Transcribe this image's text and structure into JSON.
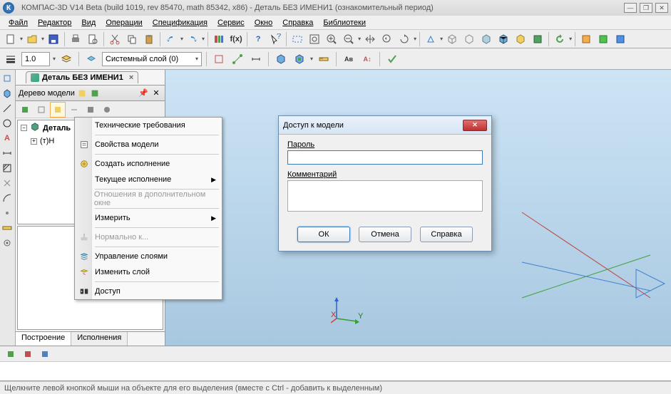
{
  "window": {
    "title": "КОМПАС-3D V14 Beta (build 1019, rev 85470, math 85342, x86) - Деталь БЕЗ ИМЕНИ1 (ознакомительный период)",
    "app_icon_letter": "К"
  },
  "menu": {
    "file": "Файл",
    "editor": "Редактор",
    "view": "Вид",
    "operations": "Операции",
    "spec": "Спецификация",
    "service": "Сервис",
    "window": "Окно",
    "help": "Справка",
    "libs": "Библиотеки"
  },
  "toolbar2": {
    "zoom_value": "1.0",
    "layer_label": "Системный слой (0)"
  },
  "doc_tab": {
    "label": "Деталь БЕЗ ИМЕНИ1"
  },
  "tree": {
    "header": "Дерево модели",
    "root": "Деталь",
    "node": "(т)Н",
    "tab_build": "Построение",
    "tab_exec": "Исполнения"
  },
  "context_menu": {
    "tech_req": "Технические требования",
    "model_props": "Свойства модели",
    "create_exec": "Создать исполнение",
    "current_exec": "Текущее исполнение",
    "relations": "Отношения в дополнительном окне",
    "measure": "Измерить",
    "normal_to": "Нормально к...",
    "layer_mgmt": "Управление слоями",
    "change_layer": "Изменить слой",
    "access": "Доступ"
  },
  "dialog": {
    "title": "Доступ к модели",
    "password_label": "Пароль",
    "comment_label": "Комментарий",
    "ok": "ОК",
    "cancel": "Отмена",
    "help": "Справка"
  },
  "canvas": {
    "axis_x": "X",
    "axis_y": "Y"
  },
  "status": {
    "hint": "Щелкните левой кнопкой мыши на объекте для его выделения (вместе с Ctrl - добавить к выделенным)"
  }
}
